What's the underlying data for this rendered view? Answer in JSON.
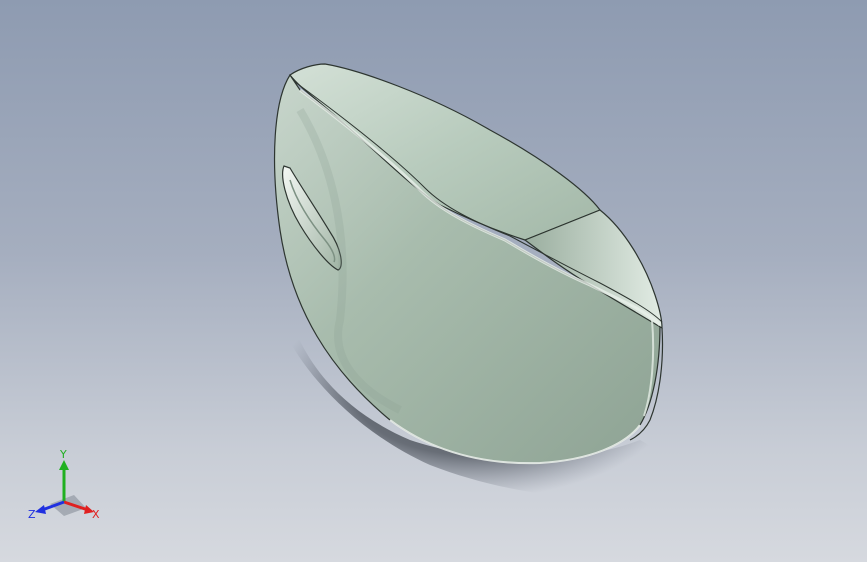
{
  "viewport": {
    "background_top": "#8e9bb1",
    "background_bottom": "#d6d9df",
    "model_color": "#a9bfae"
  },
  "triad": {
    "x_label": "X",
    "y_label": "Y",
    "z_label": "Z",
    "x_color": "#e02020",
    "y_color": "#20b020",
    "z_color": "#2030e0"
  }
}
